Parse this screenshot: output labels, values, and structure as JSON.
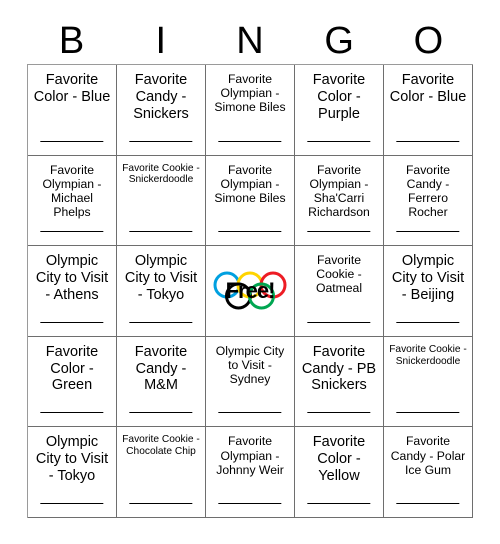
{
  "card": {
    "title": "BINGO Card",
    "header_letters": [
      "B",
      "I",
      "N",
      "G",
      "O"
    ],
    "free_space": {
      "label": "Free!",
      "icon": "olympic-rings-icon",
      "ring_colors": [
        "#00a0e0",
        "#ffd400",
        "#000000",
        "#00a651",
        "#ed1c24"
      ]
    },
    "cells": [
      {
        "text": "Favorite Color - Blue",
        "size": "lg",
        "column": "B",
        "row": 1
      },
      {
        "text": "Favorite Candy - Snickers",
        "size": "lg",
        "column": "I",
        "row": 1
      },
      {
        "text": "Favorite Olympian - Simone Biles",
        "size": "md",
        "column": "N",
        "row": 1
      },
      {
        "text": "Favorite Color - Purple",
        "size": "lg",
        "column": "G",
        "row": 1
      },
      {
        "text": "Favorite Color - Blue",
        "size": "lg",
        "column": "O",
        "row": 1
      },
      {
        "text": "Favorite Olympian - Michael Phelps",
        "size": "md",
        "column": "B",
        "row": 2
      },
      {
        "text": "Favorite Cookie - Snickerdoodle",
        "size": "sm",
        "column": "I",
        "row": 2
      },
      {
        "text": "Favorite Olympian - Simone Biles",
        "size": "md",
        "column": "N",
        "row": 2
      },
      {
        "text": "Favorite Olympian - Sha'Carri Richardson",
        "size": "md",
        "column": "G",
        "row": 2
      },
      {
        "text": "Favorite Candy - Ferrero Rocher",
        "size": "md",
        "column": "O",
        "row": 2
      },
      {
        "text": "Olympic City to Visit - Athens",
        "size": "lg",
        "column": "B",
        "row": 3
      },
      {
        "text": "Olympic City to Visit - Tokyo",
        "size": "lg",
        "column": "I",
        "row": 3
      },
      {
        "text": "Free!",
        "size": "free",
        "column": "N",
        "row": 3
      },
      {
        "text": "Favorite Cookie - Oatmeal",
        "size": "md",
        "column": "G",
        "row": 3
      },
      {
        "text": "Olympic City to Visit - Beijing",
        "size": "lg",
        "column": "O",
        "row": 3
      },
      {
        "text": "Favorite Color - Green",
        "size": "lg",
        "column": "B",
        "row": 4
      },
      {
        "text": "Favorite Candy - M&M",
        "size": "lg",
        "column": "I",
        "row": 4
      },
      {
        "text": "Olympic City to Visit - Sydney",
        "size": "md",
        "column": "N",
        "row": 4
      },
      {
        "text": "Favorite Candy - PB Snickers",
        "size": "lg",
        "column": "G",
        "row": 4
      },
      {
        "text": "Favorite Cookie - Snickerdoodle",
        "size": "sm",
        "column": "O",
        "row": 4
      },
      {
        "text": "Olympic City to Visit - Tokyo",
        "size": "lg",
        "column": "B",
        "row": 5
      },
      {
        "text": "Favorite Cookie - Chocolate Chip",
        "size": "sm",
        "column": "I",
        "row": 5
      },
      {
        "text": "Favorite Olympian - Johnny Weir",
        "size": "md",
        "column": "N",
        "row": 5
      },
      {
        "text": "Favorite Color - Yellow",
        "size": "lg",
        "column": "G",
        "row": 5
      },
      {
        "text": "Favorite Candy - Polar Ice Gum",
        "size": "md",
        "column": "O",
        "row": 5
      }
    ]
  }
}
